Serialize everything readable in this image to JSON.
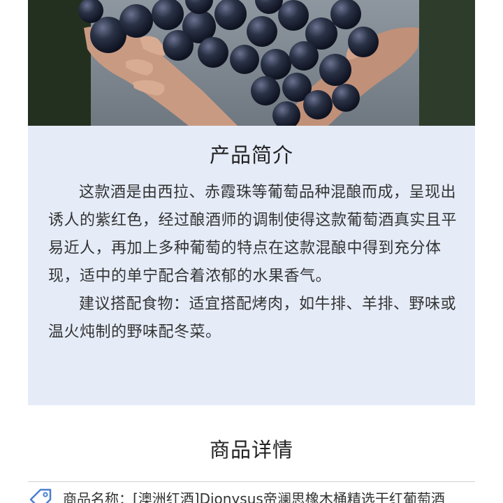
{
  "intro": {
    "title": "产品简介",
    "paragraph1": "这款酒是由西拉、赤霞珠等葡萄品种混酿而成，呈现出诱人的紫红色，经过酿酒师的调制使得这款葡萄酒真实且平易近人，再加上多种葡萄的特点在这款混酿中得到充分体现，适中的单宁配合着浓郁的水果香气。",
    "paragraph2": "建议搭配食物：适宜搭配烤肉，如牛排、羊排、野味或温火炖制的野味配冬菜。"
  },
  "details": {
    "title": "商品详情",
    "items": [
      {
        "label": "商品名称：[澳洲红酒]Dionysus帝澜思橡木桶精选干红葡萄酒"
      }
    ]
  },
  "colors": {
    "panel_bg": "#e5ecf8",
    "grape": "#2a3246",
    "hand": "#c99a82"
  },
  "icons": {
    "detail_tag": "tag-icon"
  }
}
